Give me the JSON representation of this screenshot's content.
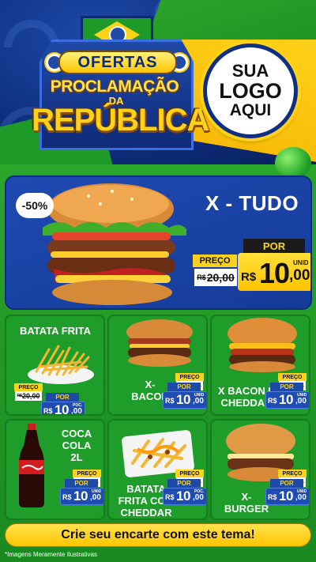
{
  "header": {
    "badge": {
      "line1": "OFERTAS",
      "line2": "PROCLAMAÇÃO",
      "line3": "DA",
      "line4": "REPÚBLICA"
    },
    "logo": {
      "line1": "SUA",
      "line2": "LOGO",
      "line3": "AQUI"
    },
    "colors": {
      "blue": "#0c2a75",
      "green": "#1d9a27",
      "yellow": "#ffd21a"
    }
  },
  "hero": {
    "discount": "-50%",
    "title": "X - TUDO",
    "preco_label": "PREÇO",
    "old_currency": "R$",
    "old_price": "20,00",
    "por_label": "POR",
    "currency": "R$",
    "price_int": "10",
    "price_dec": ",00",
    "unit": "UNID"
  },
  "products": [
    {
      "title": "BATATA FRITA",
      "image": "fries-icon",
      "preco_label": "PREÇO",
      "old_currency": "R$",
      "old_price": "20,00",
      "por_label": "POR",
      "currency": "R$",
      "price_int": "10",
      "price_dec": ",00",
      "unit": "POC."
    },
    {
      "title": "X-\nBACON",
      "image": "bacon-burger-icon",
      "preco_label": "PREÇO",
      "old_currency": "R$",
      "old_price": "20,00",
      "por_label": "POR",
      "currency": "R$",
      "price_int": "10",
      "price_dec": ",00",
      "unit": "UNID"
    },
    {
      "title": "X BACON E\nCHEDDAR",
      "image": "cheddar-burger-icon",
      "preco_label": "PREÇO",
      "old_currency": "R$",
      "old_price": "20,00",
      "por_label": "POR",
      "currency": "R$",
      "price_int": "10",
      "price_dec": ",00",
      "unit": "UNID"
    },
    {
      "title": "COCA\nCOLA\n2L",
      "image": "soda-bottle-icon",
      "preco_label": "PREÇO",
      "old_currency": "R$",
      "old_price": "20,00",
      "por_label": "POR",
      "currency": "R$",
      "price_int": "10",
      "price_dec": ",00",
      "unit": "UNID"
    },
    {
      "title": "BATATA\nFRITA COM\nCHEDDAR",
      "image": "cheddar-fries-icon",
      "preco_label": "PREÇO",
      "old_currency": "R$",
      "old_price": "20,00",
      "por_label": "POR",
      "currency": "R$",
      "price_int": "10",
      "price_dec": ",00",
      "unit": "POC."
    },
    {
      "title": "X-\nBURGER",
      "image": "burger-icon",
      "preco_label": "PREÇO",
      "old_currency": "R$",
      "old_price": "20,00",
      "por_label": "POR",
      "currency": "R$",
      "price_int": "10",
      "price_dec": ",00",
      "unit": "UNID"
    }
  ],
  "cta": {
    "label": "Crie seu encarte com este tema!"
  },
  "footnote": "*Imagens Meramente Ilustrativas"
}
